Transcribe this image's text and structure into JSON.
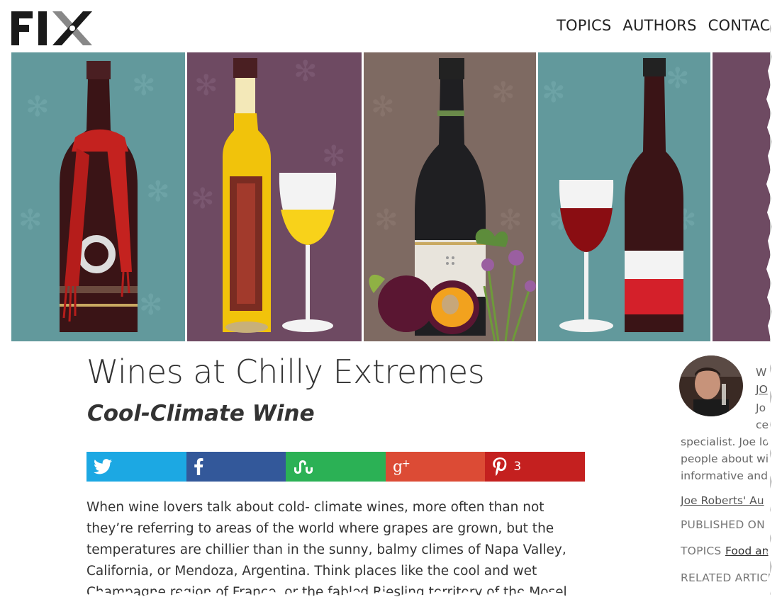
{
  "header": {
    "logo_text": "FIX",
    "nav": [
      "TOPICS",
      "AUTHORS",
      "CONTAC"
    ]
  },
  "hero": {
    "panel_colors": [
      "#62999c",
      "#6e4a62",
      "#7e6a62",
      "#62999c",
      "#6e4a62"
    ]
  },
  "article": {
    "title": "Wines at Chilly Extremes",
    "subtitle": "Cool-Climate Wine",
    "share": {
      "twitter_color": "#1ca8e3",
      "facebook_color": "#33589a",
      "stumbleupon_color": "#2bb155",
      "googleplus_color": "#dc4b35",
      "pinterest_color": "#c4201f",
      "pinterest_count": "3"
    },
    "body": "When wine lovers talk about cold- climate wines, more often than not they’re referring to areas of the world where grapes are grown, but the temperatures are chillier than in the sunny, balmy climes of Napa Valley, California, or Mendoza, Argentina. Think places like the cool and wet Champagne region of France, or the fabled Riesling territory of the Mosel in"
  },
  "sidebar": {
    "written_by": "W",
    "author_link": "JO",
    "bio_line1": "Jo",
    "bio_line2": "ce",
    "bio_line3": "specialist. Joe lo",
    "bio_line4": "people about wi",
    "bio_line5": "informative and",
    "author_page_link": "Joe Roberts' Au",
    "published_label": "PUBLISHED ON",
    "topics_label": "TOPICS",
    "topics_link": "Food an",
    "related_label": "RELATED ARTICL"
  }
}
